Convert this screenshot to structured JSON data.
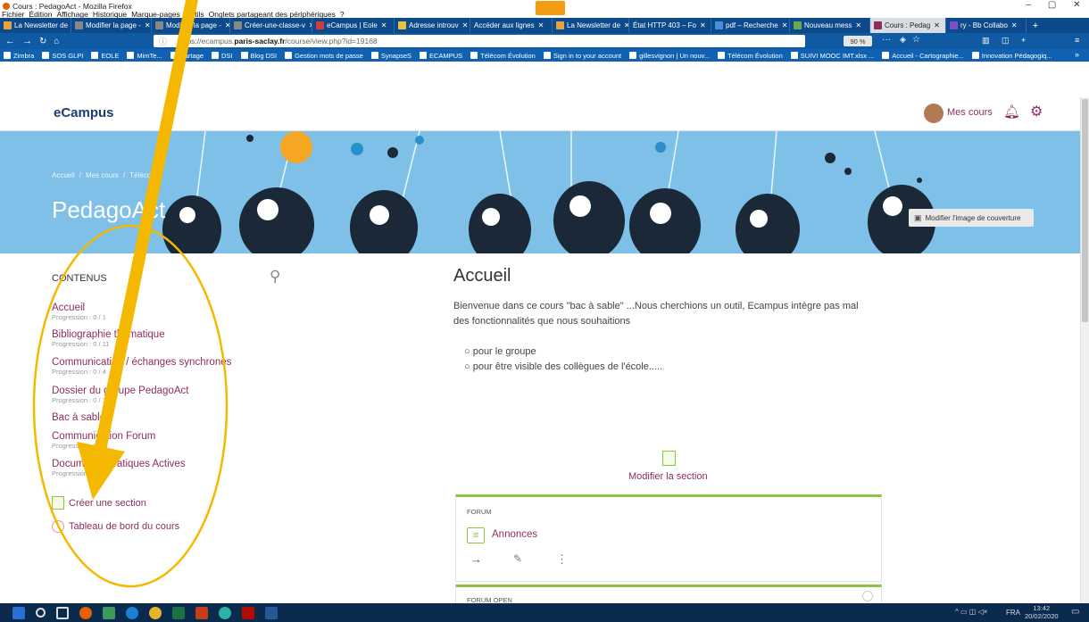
{
  "window": {
    "title": "Cours : PedagoAct - Mozilla Firefox",
    "controls": [
      "–",
      "▢",
      "✕"
    ]
  },
  "menu": [
    "Fichier",
    "Édition",
    "Affichage",
    "Historique",
    "Marque-pages",
    "Outils",
    "Onglets partageant des périphériques",
    "?"
  ],
  "tabs": [
    {
      "label": "La Newsletter de",
      "color": "#e8a33c"
    },
    {
      "label": "Modifier la page -",
      "color": "#888888"
    },
    {
      "label": "Modifier la page -",
      "color": "#888888"
    },
    {
      "label": "Créer-une-classe-v",
      "color": "#888888"
    },
    {
      "label": "eCampus | Eole",
      "color": "#d33b3b"
    },
    {
      "label": "Adresse introuv",
      "color": "#e8c23c"
    },
    {
      "label": "Accéder aux lignes",
      "color": "#888888"
    },
    {
      "label": "La Newsletter de",
      "color": "#e8a33c"
    },
    {
      "label": "État HTTP 403 – Fo",
      "color": "#888888"
    },
    {
      "label": "pdf – Recherche",
      "color": "#4a90d9"
    },
    {
      "label": "Nouveau mess",
      "color": "#6aa84f"
    },
    {
      "label": "Cours : Pedag",
      "color": "#8f2c5e",
      "active": true
    },
    {
      "label": "ry - Bb Collabo",
      "color": "#7b4fc9"
    }
  ],
  "nav": {
    "url_prefix": "https://ecampus.",
    "url_domain": "paris-saclay.fr",
    "url_path": "/course/view.php?id=19168",
    "zoom": "90 %",
    "more": "···"
  },
  "bookmarks": [
    "Zimbra",
    "SOS GLPI",
    "EOLE",
    "MimTe...",
    "Partage",
    "DSI",
    "Blog DSI",
    "Gestion mots de passe",
    "SynapseS",
    "ECAMPUS",
    "Télécom Évolution",
    "Sign in to your account",
    "gillesvignon | Un nouv...",
    "Télécom Évolution",
    "SUIVI MOOC IMT.xlsx ...",
    "Accueil - Cartographie...",
    "Innovation Pédagogiq..."
  ],
  "site": {
    "brand": "eCampus",
    "mes_cours": "Mes cours"
  },
  "banner": {
    "breadcrumb": [
      "Accueil",
      "Mes cours",
      "Télécom..."
    ],
    "course_title": "PedagoAct",
    "edit_cover": "Modifier l'image de couverture"
  },
  "sidebar": {
    "heading": "CONTENUS",
    "items": [
      {
        "title": "Accueil",
        "progress": "Progression : 0 / 1"
      },
      {
        "title": "Bibliographie thématique",
        "progress": "Progression : 0 / 11"
      },
      {
        "title": "Communication / échanges synchrones",
        "progress": "Progression : 0 / 4"
      },
      {
        "title": "Dossier du groupe PedagoAct",
        "progress": "Progression : 0 / 1"
      },
      {
        "title": "Bac à sable",
        "progress": ""
      },
      {
        "title": "Communication Forum",
        "progress": "Progression : 0 / 2"
      },
      {
        "title": "Documents Pratiques Actives",
        "progress": "Progression : 0 / 14"
      }
    ],
    "create_section": "Créer une section",
    "dashboard": "Tableau de bord du cours"
  },
  "content": {
    "heading": "Accueil",
    "intro_line1": "Bienvenue dans ce cours \"bac à sable\" ...Nous cherchions un outil, Ecampus intègre pas mal",
    "intro_line2": "des fonctionnalités que nous souhaitions",
    "bullets": [
      "pour le groupe",
      "pour être visible des collègues de l'école....."
    ],
    "edit_section": "Modifier la section",
    "card1_type": "FORUM",
    "card1_title": "Annonces",
    "card2_type": "FORUM OPEN"
  },
  "taskbar": {
    "lang": "FRA",
    "time": "13:42",
    "date": "20/02/2020"
  },
  "colors": {
    "accent_green": "#8cc63f",
    "link": "#8f2c5e",
    "annotation_yellow": "#f5b800",
    "banner": "#7ec0e8"
  }
}
